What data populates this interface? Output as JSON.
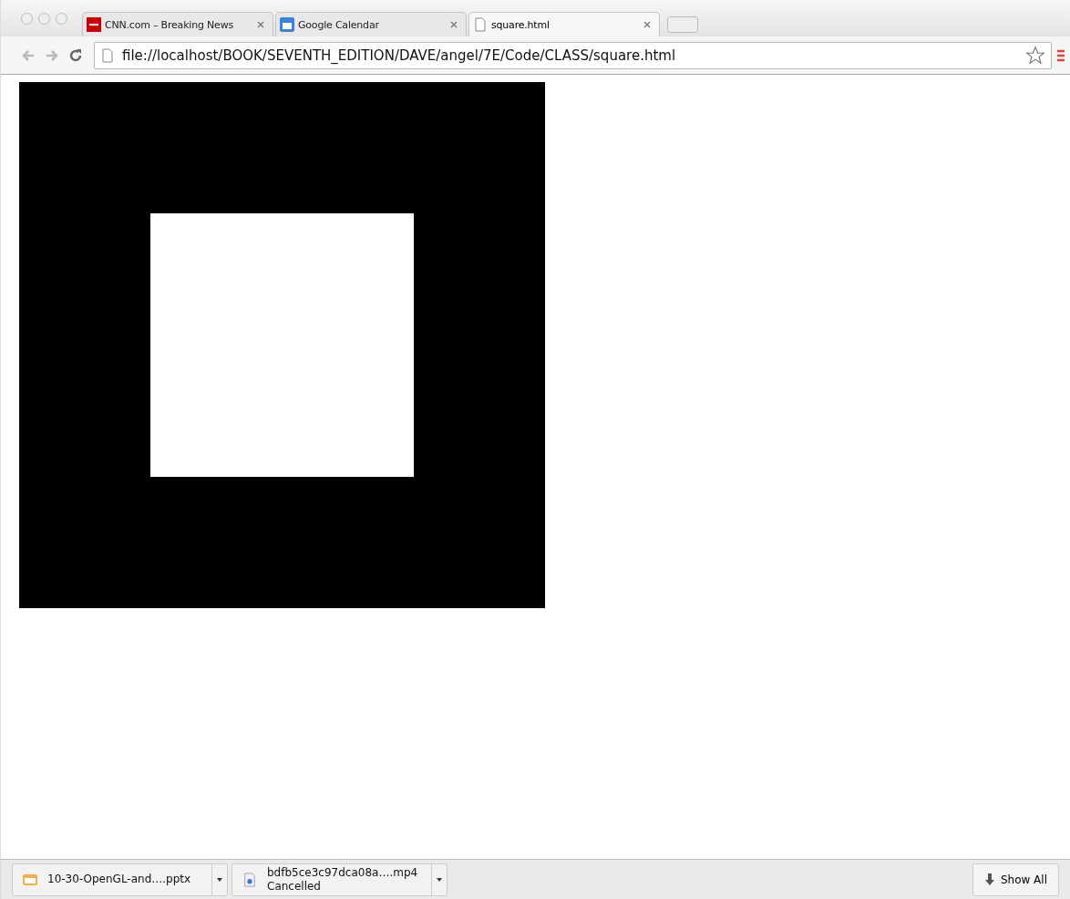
{
  "tabs": [
    {
      "title": "CNN.com – Breaking News",
      "kind": "cnn",
      "selected": false
    },
    {
      "title": "Google Calendar",
      "kind": "calendar",
      "selected": false
    },
    {
      "title": "square.html",
      "kind": "page",
      "selected": true
    }
  ],
  "address": {
    "value": "file://localhost/BOOK/SEVENTH_EDITION/DAVE/angel/7E/Code/CLASS/square.html"
  },
  "downloads": [
    {
      "name": "10-30-OpenGL-and….pptx",
      "kind": "slides"
    },
    {
      "name": "bdfb5ce3c97dca08a….mp4",
      "status": "Cancelled",
      "kind": "video"
    }
  ],
  "show_all": "Show All"
}
